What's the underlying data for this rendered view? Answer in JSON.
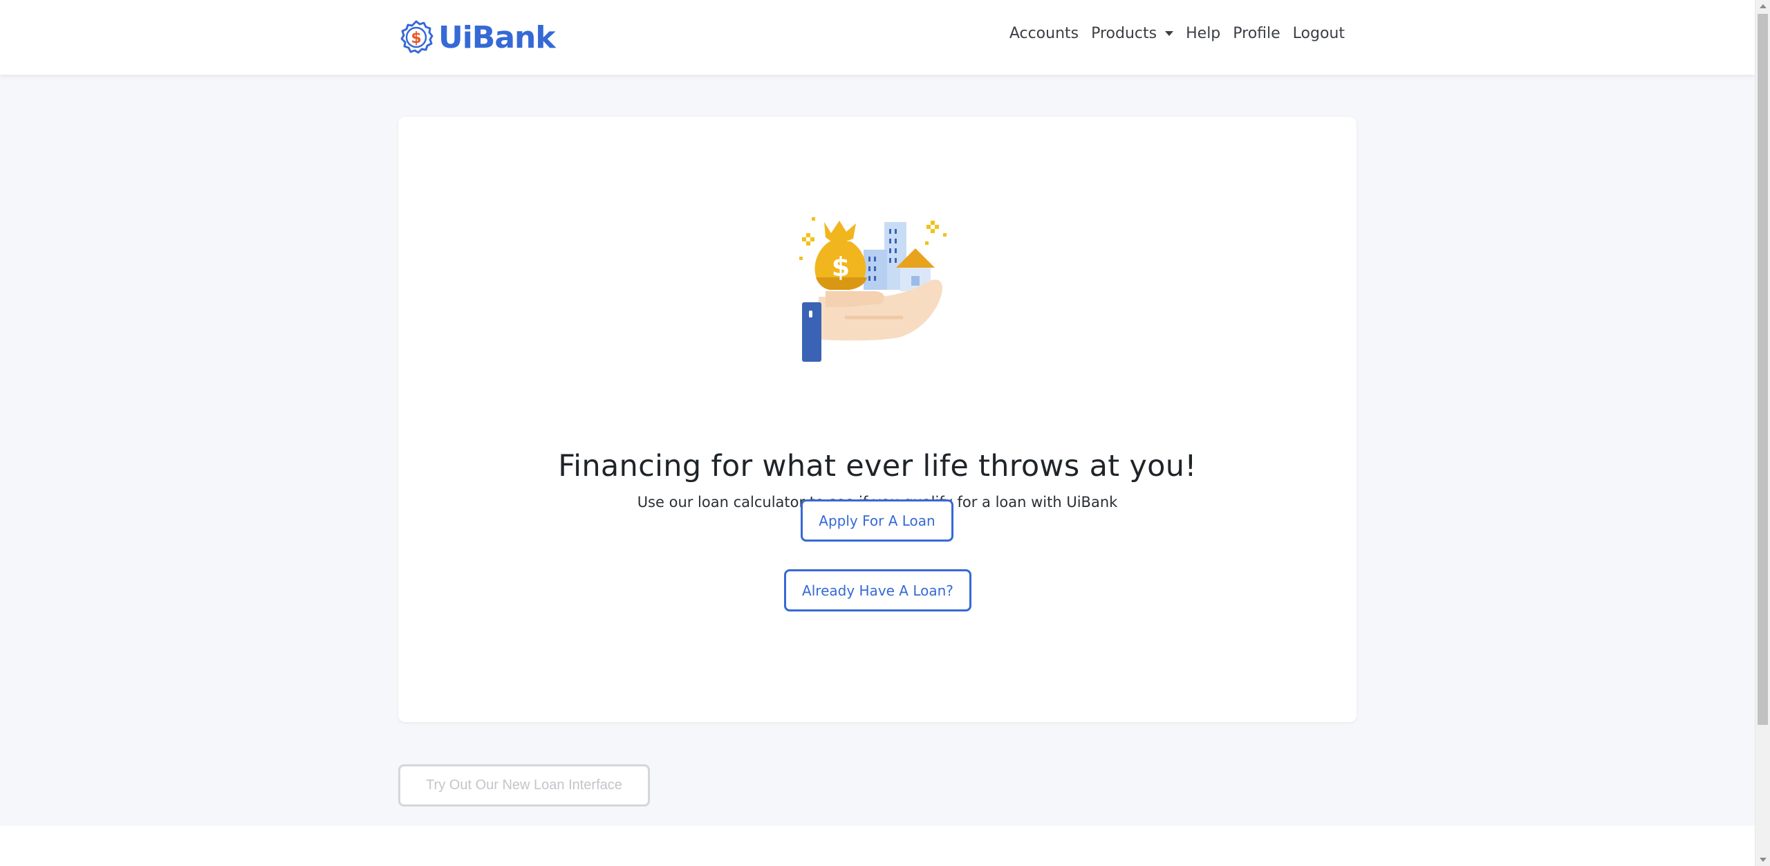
{
  "brand": {
    "name": "UiBank",
    "icon": "dollar-badge-icon",
    "color": "#3569d6",
    "icon_accent": "#e8572a"
  },
  "nav": {
    "items": [
      {
        "label": "Accounts"
      },
      {
        "label": "Products",
        "has_dropdown": true
      },
      {
        "label": "Help"
      },
      {
        "label": "Profile"
      },
      {
        "label": "Logout"
      }
    ]
  },
  "hero": {
    "illustration": "hand-holding-money-bag-and-buildings-icon",
    "headline": "Financing for what ever life throws at you!",
    "subtext": "Use our loan calculator to see if you qualify for a loan with UiBank"
  },
  "actions": {
    "apply_label": "Apply For A Loan",
    "already_label": "Already Have A Loan?",
    "try_label": "Try Out Our New Loan Interface"
  },
  "colors": {
    "accent": "#3569d6",
    "page_bg": "#f6f7fa",
    "card_bg": "#ffffff",
    "muted": "#c2c5ca"
  }
}
